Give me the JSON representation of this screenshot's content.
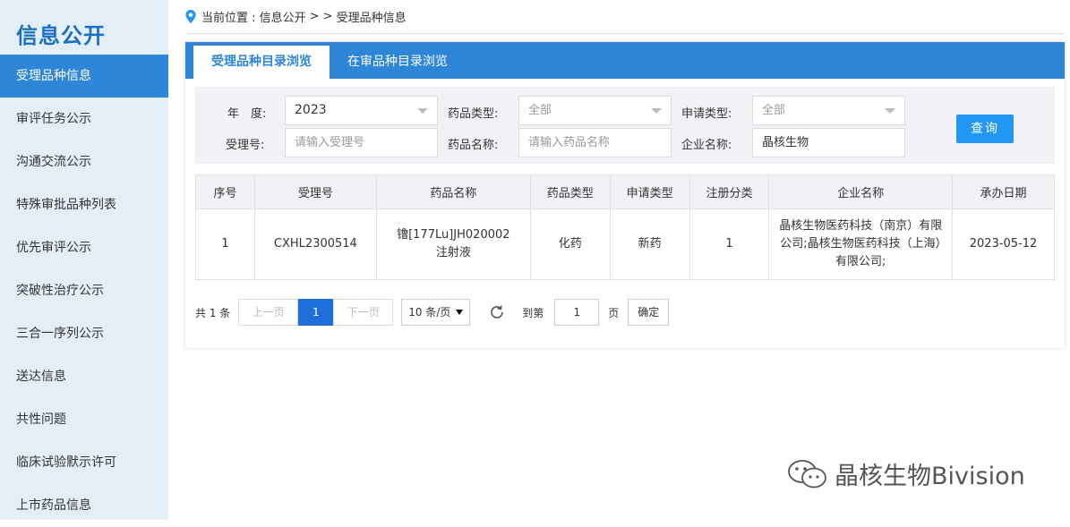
{
  "sidebar": {
    "title": "信息公开",
    "items": [
      {
        "label": "受理品种信息",
        "active": true
      },
      {
        "label": "审评任务公示"
      },
      {
        "label": "沟通交流公示"
      },
      {
        "label": "特殊审批品种列表"
      },
      {
        "label": "优先审评公示"
      },
      {
        "label": "突破性治疗公示"
      },
      {
        "label": "三合一序列公示"
      },
      {
        "label": "送达信息"
      },
      {
        "label": "共性问题"
      },
      {
        "label": "临床试验默示许可"
      },
      {
        "label": "上市药品信息"
      }
    ]
  },
  "breadcrumb": {
    "prefix": "当前位置 : 信息公开",
    "sep": "> >",
    "current": "受理品种信息"
  },
  "tabs": [
    {
      "label": "受理品种目录浏览",
      "active": true
    },
    {
      "label": "在审品种目录浏览"
    }
  ],
  "filter": {
    "year_label": "年　度:",
    "year_value": "2023",
    "drug_type_label": "药品类型:",
    "drug_type_value": "全部",
    "apply_type_label": "申请类型:",
    "apply_type_value": "全部",
    "accept_no_label": "受理号:",
    "accept_no_placeholder": "请输入受理号",
    "drug_name_label": "药品名称:",
    "drug_name_placeholder": "请输入药品名称",
    "company_label": "企业名称:",
    "company_value": "晶核生物",
    "query_button": "查询"
  },
  "table": {
    "headers": [
      "序号",
      "受理号",
      "药品名称",
      "药品类型",
      "申请类型",
      "注册分类",
      "企业名称",
      "承办日期"
    ],
    "rows": [
      [
        "1",
        "CXHL2300514",
        "镥[177Lu]JH020002注射液",
        "化药",
        "新药",
        "1",
        "晶核生物医药科技（南京）有限公司;晶核生物医药科技（上海）有限公司;",
        "2023-05-12"
      ]
    ]
  },
  "pager": {
    "total": "共 1 条",
    "prev": "上一页",
    "current": "1",
    "next": "下一页",
    "page_size": "10 条/页",
    "goto_label": "到第",
    "goto_value": "1",
    "page_unit": "页",
    "confirm": "确定"
  },
  "watermark": {
    "text": "晶核生物Bivision"
  }
}
